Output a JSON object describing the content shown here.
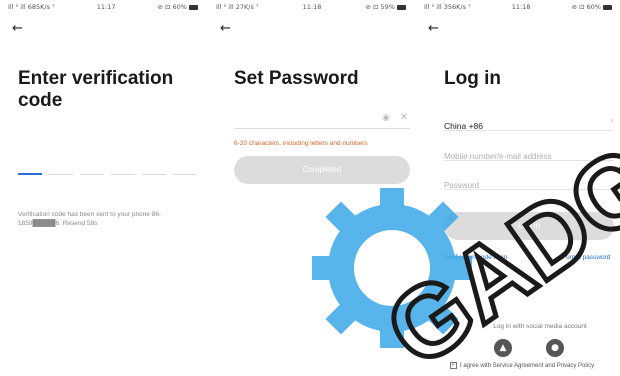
{
  "panel1": {
    "status": {
      "left": "Ill ⁰ ill 685K/s ⁷",
      "time": "11:17",
      "right": "⊘ ⊡ 60%"
    },
    "title": "Enter verification code",
    "hint": "Verification code has been sent to your phone 86-1859█████6. Resend 58s"
  },
  "panel2": {
    "status": {
      "left": "Ill ⁰ ill 27K/s ⁷",
      "time": "11:18",
      "right": "⊘ ⊡ 59%"
    },
    "title": "Set Password",
    "password_placeholder": "",
    "warning": "6-20 characters, including letters and numbers",
    "complete_label": "Completed"
  },
  "panel3": {
    "status": {
      "left": "Ill ⁰ ill 356K/s ⁷",
      "time": "11:18",
      "right": "⊘ ⊡ 60%"
    },
    "title": "Log in",
    "country": "China +86",
    "account_placeholder": "Mobile number/e-mail address",
    "password_placeholder": "Password",
    "login_label": "Log in",
    "verification_login": "Verification code login",
    "forgot_password": "Forgot password",
    "social_label": "Log in with social media account",
    "agreement": "I agree with Service Agreement and Privacy Policy"
  },
  "watermark": "GADG",
  "colors": {
    "accent": "#2a6fd6",
    "warning": "#d2642a",
    "disabled_button": "#dcdcdc",
    "watermark_gear": "#3aa9e8"
  }
}
